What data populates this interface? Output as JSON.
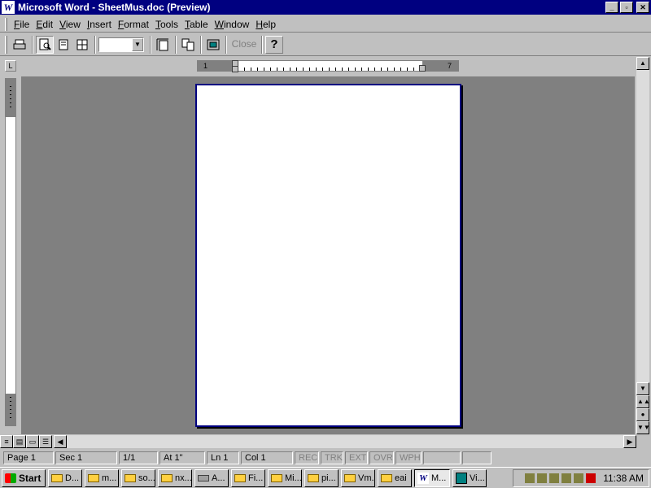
{
  "window": {
    "title": "Microsoft Word - SheetMus.doc (Preview)",
    "app_icon_glyph": "W",
    "controls": [
      "minimize",
      "restore",
      "close"
    ]
  },
  "menu": {
    "items": [
      {
        "label": "File"
      },
      {
        "label": "Edit"
      },
      {
        "label": "View"
      },
      {
        "label": "Insert"
      },
      {
        "label": "Format"
      },
      {
        "label": "Tools"
      },
      {
        "label": "Table"
      },
      {
        "label": "Window"
      },
      {
        "label": "Help"
      }
    ]
  },
  "toolbar": {
    "zoom_value": "",
    "close_label": "Close",
    "help_glyph": "?"
  },
  "ruler": {
    "h_left_number": "1",
    "h_right_number": "7"
  },
  "statusbar": {
    "page": "Page 1",
    "sec": "Sec 1",
    "pages": "1/1",
    "at": "At 1\"",
    "ln": "Ln 1",
    "col": "Col 1",
    "rec": "REC",
    "trk": "TRK",
    "ext": "EXT",
    "ovr": "OVR",
    "wph": "WPH"
  },
  "taskbar": {
    "start_label": "Start",
    "tasks": [
      {
        "label": "D...",
        "icon": "folder-icon"
      },
      {
        "label": "m...",
        "icon": "folder-icon"
      },
      {
        "label": "so...",
        "icon": "folder-icon"
      },
      {
        "label": "nx...",
        "icon": "folder-icon"
      },
      {
        "label": "A...",
        "icon": "drive-icon"
      },
      {
        "label": "Fi...",
        "icon": "folder-icon"
      },
      {
        "label": "Mi...",
        "icon": "folder-icon"
      },
      {
        "label": "pi...",
        "icon": "folder-icon"
      },
      {
        "label": "Vm...",
        "icon": "folder-icon"
      },
      {
        "label": "eai",
        "icon": "folder-icon"
      },
      {
        "label": "M...",
        "icon": "word-icon"
      },
      {
        "label": "Vi...",
        "icon": "visio-icon"
      }
    ],
    "clock": "11:38 AM"
  },
  "colors": {
    "title_bar": "#000080",
    "workspace": "#808080",
    "chrome": "#c0c0c0",
    "page_border": "#000080"
  }
}
